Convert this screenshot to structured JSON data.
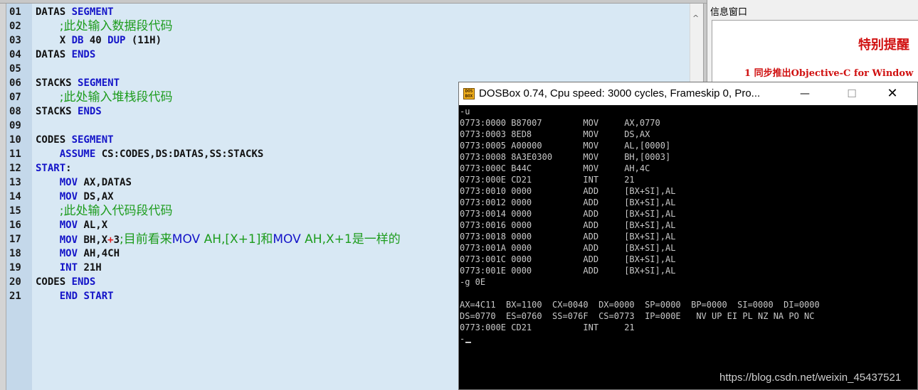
{
  "editor": {
    "lines": [
      {
        "n": "01",
        "code": "DATAS SEGMENT"
      },
      {
        "n": "02",
        "code": "    ;此处输入数据段代码"
      },
      {
        "n": "03",
        "code": "    X DB 40 DUP (11H)"
      },
      {
        "n": "04",
        "code": "DATAS ENDS"
      },
      {
        "n": "05",
        "code": ""
      },
      {
        "n": "06",
        "code": "STACKS SEGMENT"
      },
      {
        "n": "07",
        "code": "    ;此处输入堆栈段代码"
      },
      {
        "n": "08",
        "code": "STACKS ENDS"
      },
      {
        "n": "09",
        "code": ""
      },
      {
        "n": "10",
        "code": "CODES SEGMENT"
      },
      {
        "n": "11",
        "code": "    ASSUME CS:CODES,DS:DATAS,SS:STACKS"
      },
      {
        "n": "12",
        "code": "START:"
      },
      {
        "n": "13",
        "code": "    MOV AX,DATAS"
      },
      {
        "n": "14",
        "code": "    MOV DS,AX"
      },
      {
        "n": "15",
        "code": "    ;此处输入代码段代码"
      },
      {
        "n": "16",
        "code": "    MOV AL,X"
      },
      {
        "n": "17",
        "code": "    MOV BH,X+3;目前看来MOV AH,[X+1]和MOV AH,X+1是一样的"
      },
      {
        "n": "18",
        "code": "    MOV AH,4CH"
      },
      {
        "n": "19",
        "code": "    INT 21H"
      },
      {
        "n": "20",
        "code": "CODES ENDS"
      },
      {
        "n": "21",
        "code": "    END START"
      }
    ]
  },
  "info": {
    "title": "信息窗口",
    "heading": "特别提醒",
    "item": "1 同步推出Objective-C for Window"
  },
  "dosbox": {
    "title": "DOSBox 0.74, Cpu speed:     3000 cycles, Frameskip  0, Pro...",
    "min_label": "—",
    "max_label": "☐",
    "close_label": "✕",
    "logo_text": "DOS BOX",
    "lines": [
      "-u",
      "0773:0000 B87007        MOV     AX,0770",
      "0773:0003 8ED8          MOV     DS,AX",
      "0773:0005 A00000        MOV     AL,[0000]",
      "0773:0008 8A3E0300      MOV     BH,[0003]",
      "0773:000C B44C          MOV     AH,4C",
      "0773:000E CD21          INT     21",
      "0773:0010 0000          ADD     [BX+SI],AL",
      "0773:0012 0000          ADD     [BX+SI],AL",
      "0773:0014 0000          ADD     [BX+SI],AL",
      "0773:0016 0000          ADD     [BX+SI],AL",
      "0773:0018 0000          ADD     [BX+SI],AL",
      "0773:001A 0000          ADD     [BX+SI],AL",
      "0773:001C 0000          ADD     [BX+SI],AL",
      "0773:001E 0000          ADD     [BX+SI],AL",
      "-g 0E",
      "",
      "AX=4C11  BX=1100  CX=0040  DX=0000  SP=0000  BP=0000  SI=0000  DI=0000",
      "DS=0770  ES=0760  SS=076F  CS=0773  IP=000E   NV UP EI PL NZ NA PO NC",
      "0773:000E CD21          INT     21",
      "-"
    ],
    "watermark": "https://blog.csdn.net/weixin_45437521"
  }
}
